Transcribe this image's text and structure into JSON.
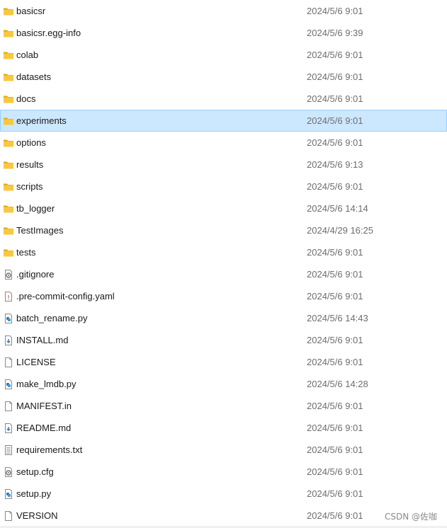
{
  "files": [
    {
      "name": "basicsr",
      "date": "2024/5/6 9:01",
      "icon": "folder-icon",
      "selected": false
    },
    {
      "name": "basicsr.egg-info",
      "date": "2024/5/6 9:39",
      "icon": "folder-icon",
      "selected": false
    },
    {
      "name": "colab",
      "date": "2024/5/6 9:01",
      "icon": "folder-icon",
      "selected": false
    },
    {
      "name": "datasets",
      "date": "2024/5/6 9:01",
      "icon": "folder-icon",
      "selected": false
    },
    {
      "name": "docs",
      "date": "2024/5/6 9:01",
      "icon": "folder-icon",
      "selected": false
    },
    {
      "name": "experiments",
      "date": "2024/5/6 9:01",
      "icon": "folder-icon",
      "selected": true
    },
    {
      "name": "options",
      "date": "2024/5/6 9:01",
      "icon": "folder-icon",
      "selected": false
    },
    {
      "name": "results",
      "date": "2024/5/6 9:13",
      "icon": "folder-icon",
      "selected": false
    },
    {
      "name": "scripts",
      "date": "2024/5/6 9:01",
      "icon": "folder-icon",
      "selected": false
    },
    {
      "name": "tb_logger",
      "date": "2024/5/6 14:14",
      "icon": "folder-icon",
      "selected": false
    },
    {
      "name": "TestImages",
      "date": "2024/4/29 16:25",
      "icon": "folder-icon",
      "selected": false
    },
    {
      "name": "tests",
      "date": "2024/5/6 9:01",
      "icon": "folder-icon",
      "selected": false
    },
    {
      "name": ".gitignore",
      "date": "2024/5/6 9:01",
      "icon": "config-file-icon",
      "selected": false
    },
    {
      "name": ".pre-commit-config.yaml",
      "date": "2024/5/6 9:01",
      "icon": "yaml-file-icon",
      "selected": false
    },
    {
      "name": "batch_rename.py",
      "date": "2024/5/6 14:43",
      "icon": "python-file-icon",
      "selected": false
    },
    {
      "name": "INSTALL.md",
      "date": "2024/5/6 9:01",
      "icon": "markdown-file-icon",
      "selected": false
    },
    {
      "name": "LICENSE",
      "date": "2024/5/6 9:01",
      "icon": "blank-file-icon",
      "selected": false
    },
    {
      "name": "make_lmdb.py",
      "date": "2024/5/6 14:28",
      "icon": "python-file-icon",
      "selected": false
    },
    {
      "name": "MANIFEST.in",
      "date": "2024/5/6 9:01",
      "icon": "blank-file-icon",
      "selected": false
    },
    {
      "name": "README.md",
      "date": "2024/5/6 9:01",
      "icon": "markdown-file-icon",
      "selected": false
    },
    {
      "name": "requirements.txt",
      "date": "2024/5/6 9:01",
      "icon": "text-file-icon",
      "selected": false
    },
    {
      "name": "setup.cfg",
      "date": "2024/5/6 9:01",
      "icon": "config-file-icon",
      "selected": false
    },
    {
      "name": "setup.py",
      "date": "2024/5/6 9:01",
      "icon": "python-file-icon",
      "selected": false
    },
    {
      "name": "VERSION",
      "date": "2024/5/6 9:01",
      "icon": "blank-file-icon",
      "selected": false
    }
  ],
  "watermark": "CSDN @佐咖",
  "colors": {
    "folder": "#f8c842",
    "selection_bg": "#cce8ff",
    "selection_border": "#99d1ff",
    "date_text": "#6d6d6d"
  }
}
